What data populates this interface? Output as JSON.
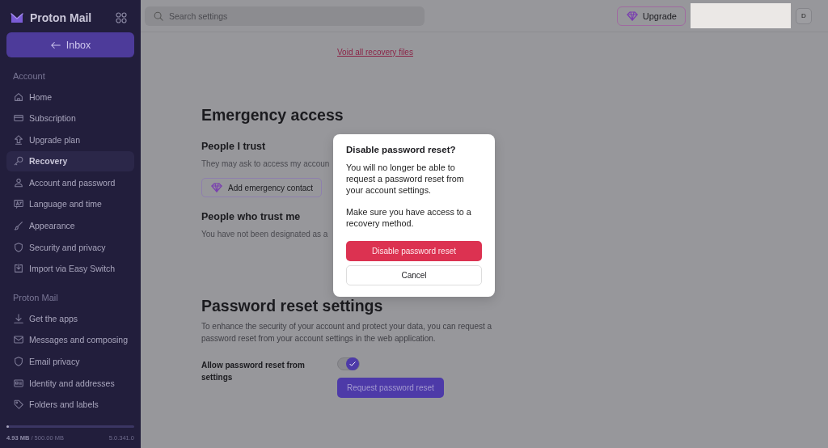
{
  "sidebar": {
    "brand": "Proton Mail",
    "inbox_button": "Inbox",
    "sections": [
      {
        "title": "Account",
        "items": [
          {
            "label": "Home",
            "selected": false
          },
          {
            "label": "Subscription",
            "selected": false
          },
          {
            "label": "Upgrade plan",
            "selected": false
          },
          {
            "label": "Recovery",
            "selected": true
          },
          {
            "label": "Account and password",
            "selected": false
          },
          {
            "label": "Language and time",
            "selected": false
          },
          {
            "label": "Appearance",
            "selected": false
          },
          {
            "label": "Security and privacy",
            "selected": false
          },
          {
            "label": "Import via Easy Switch",
            "selected": false
          }
        ]
      },
      {
        "title": "Proton Mail",
        "items": [
          {
            "label": "Get the apps",
            "selected": false
          },
          {
            "label": "Messages and composing",
            "selected": false
          },
          {
            "label": "Email privacy",
            "selected": false
          },
          {
            "label": "Identity and addresses",
            "selected": false
          },
          {
            "label": "Folders and labels",
            "selected": false
          }
        ]
      }
    ],
    "storage": {
      "level": 0.02,
      "text": "**4.93 MB** / 500.00 MB"
    },
    "version": "5.0.341.0"
  },
  "header": {
    "search": {
      "placeholder": "Search settings"
    },
    "upgrade_button": "Upgrade",
    "avatar": "D"
  },
  "content": {
    "void_link": "Void all recovery files",
    "emergency": {
      "title": "Emergency access",
      "trust_title": "People I trust",
      "trust_text": "They may ask to access my accoun",
      "add_button": "Add emergency contact",
      "trusted_by_title": "People who trust me",
      "trusted_by_text": "You have not been designated as a"
    },
    "password_reset": {
      "title": "Password reset settings",
      "text": "To enhance the security of your account and protect your data, you can request a password reset from your account settings in the web application.",
      "setting_label": "Allow password reset from settings",
      "checked": true,
      "request_button": "Request password reset"
    }
  },
  "dialog": {
    "title": "Disable password reset?",
    "paragraphs": [
      "You will no longer be able to request a password reset from your account settings.",
      "Make sure you have access to a recovery method."
    ],
    "confirm_button": "Disable password reset",
    "cancel_button": "Cancel"
  }
}
